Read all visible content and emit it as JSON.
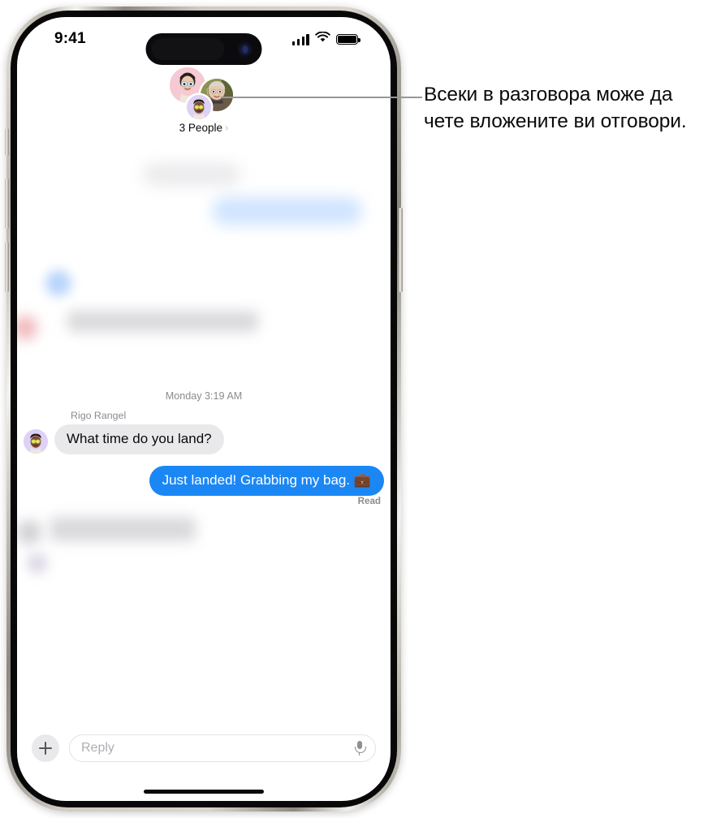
{
  "device": {
    "name": "iphone-15-pro",
    "frame_color": "#cfcac2",
    "bezel_color": "#080808"
  },
  "status_bar": {
    "time": "9:41",
    "icons": [
      "cellular-signal-icon",
      "wifi-icon",
      "battery-icon"
    ],
    "signal_bars": 4,
    "battery_full": true
  },
  "conversation_header": {
    "participants_label": "3 People",
    "chevron": "›",
    "avatars": [
      {
        "name": "avatar-pink-memoji",
        "bg": "#f6c9d4"
      },
      {
        "name": "avatar-photo-person",
        "bg": "#8c8f5a"
      },
      {
        "name": "avatar-purple-memoji",
        "bg": "#ddd2f5"
      }
    ]
  },
  "thread": {
    "timestamp": "Monday 3:19 AM",
    "messages": [
      {
        "id": "msg-incoming-1",
        "sender": "Rigo Rangel",
        "text": "What time do you land?",
        "direction": "incoming",
        "bubble_color": "#e9e9eb",
        "text_color": "#0a0a0a"
      },
      {
        "id": "msg-outgoing-1",
        "sender": "",
        "text": "Just landed! Grabbing my bag. 💼",
        "direction": "outgoing",
        "bubble_color": "#1b87f5",
        "text_color": "#ffffff"
      }
    ],
    "read_receipt": "Read",
    "blurred_messages_above": 4,
    "blurred_messages_below": 2
  },
  "input_bar": {
    "add_button_icon": "plus-icon",
    "reply_placeholder": "Reply",
    "reply_value": "",
    "mic_icon": "microphone-icon"
  },
  "callout": {
    "text": "Всеки в разговора може да чете вложените ви отговори.",
    "line_color": "#97979b"
  }
}
